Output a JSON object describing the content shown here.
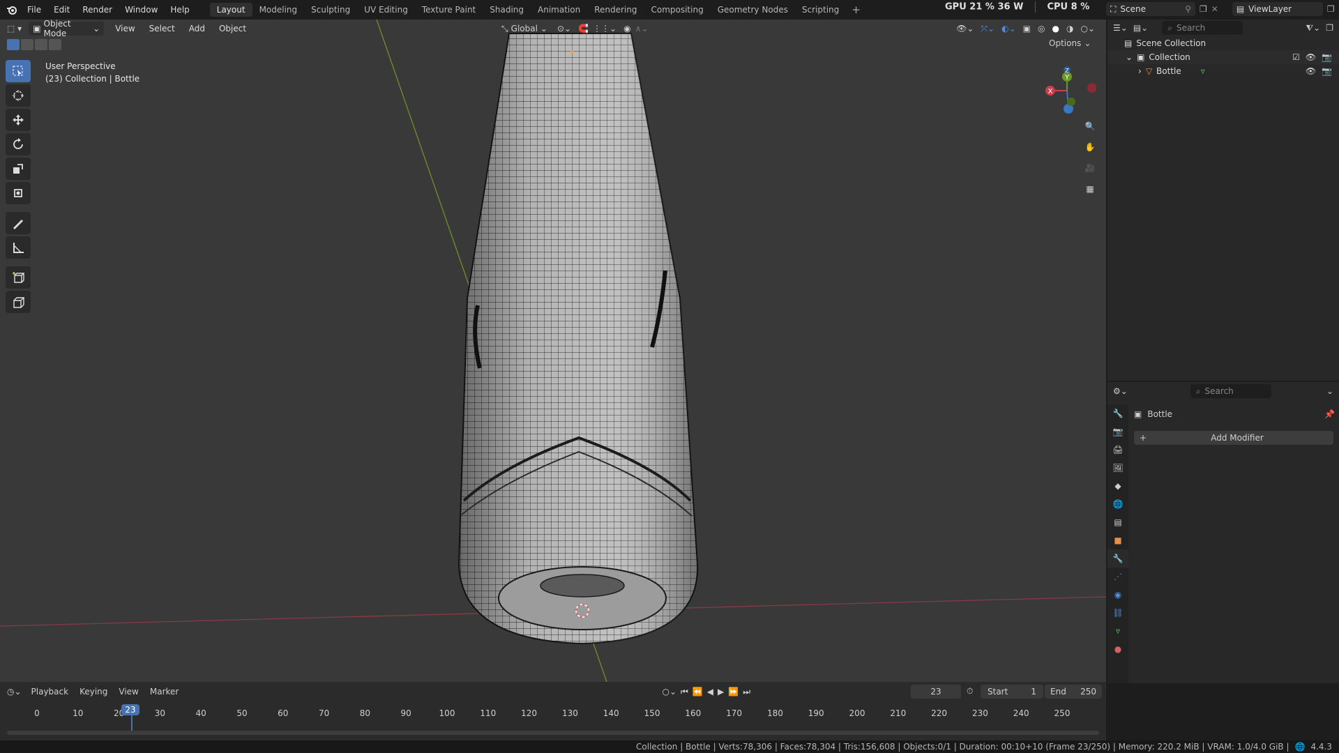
{
  "menu": [
    "File",
    "Edit",
    "Render",
    "Window",
    "Help"
  ],
  "workspaces": [
    "Layout",
    "Modeling",
    "Sculpting",
    "UV Editing",
    "Texture Paint",
    "Shading",
    "Animation",
    "Rendering",
    "Compositing",
    "Geometry Nodes",
    "Scripting"
  ],
  "active_workspace": "Layout",
  "stats": {
    "gpu": "GPU  21 %  36 W",
    "cpu": "CPU  8 %"
  },
  "scene": {
    "name": "Scene",
    "view_layer": "ViewLayer"
  },
  "viewport": {
    "mode": "Object Mode",
    "menus": [
      "View",
      "Select",
      "Add",
      "Object"
    ],
    "orientation": "Global",
    "options_label": "Options",
    "info_line1": "User Perspective",
    "info_line2": "(23) Collection | Bottle"
  },
  "outliner": {
    "search_placeholder": "Search",
    "scene_collection": "Scene Collection",
    "collection": "Collection",
    "object": "Bottle"
  },
  "properties": {
    "search_placeholder": "Search",
    "object": "Bottle",
    "add_modifier": "Add Modifier"
  },
  "timeline": {
    "menus": [
      "Playback",
      "Keying",
      "View",
      "Marker"
    ],
    "current_frame": "23",
    "start_label": "Start",
    "start": "1",
    "end_label": "End",
    "end": "250",
    "ticks": [
      "0",
      "10",
      "20",
      "30",
      "40",
      "50",
      "60",
      "70",
      "80",
      "90",
      "100",
      "110",
      "120",
      "130",
      "140",
      "150",
      "160",
      "170",
      "180",
      "190",
      "200",
      "210",
      "220",
      "230",
      "240",
      "250"
    ]
  },
  "status": "Collection | Bottle | Verts:78,306 | Faces:78,304 | Tris:156,608 | Objects:0/1 | Duration: 00:10+10 (Frame 23/250) | Memory: 220.2 MiB | VRAM: 1.0/4.0 GiB |",
  "version": "4.4.3",
  "gizmo_axes": {
    "x": "X",
    "y": "Y",
    "z": "Z"
  },
  "colors": {
    "accent": "#4772b3",
    "viewport_bg": "#393939",
    "panel_bg": "#282828",
    "x_axis": "#c8404f",
    "y_axis": "#6a9a23",
    "z_axis": "#3a78c2"
  }
}
